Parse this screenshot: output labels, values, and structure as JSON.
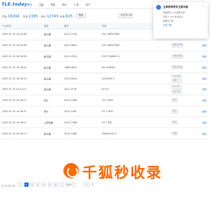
{
  "header": {
    "logo_text": "TLE.today",
    "nav": [
      "首页",
      "卫星",
      "发射",
      "碎片",
      "工具",
      "关于"
    ]
  },
  "stats": {
    "items": [
      {
        "label": "在轨",
        "value": "18294"
      },
      {
        "label": "失效",
        "value": "2395"
      },
      {
        "label": "碎片",
        "value": "12743"
      },
      {
        "label": "未知",
        "value": "825"
      }
    ],
    "search_label": "搜索",
    "sort_label": "按发射时间"
  },
  "table": {
    "columns": [
      "TLE时间",
      "类型",
      "编号",
      "名称",
      "",
      ""
    ],
    "rows": [
      {
        "time": "2025-07-15 10:44:48",
        "type": "航天器",
        "orb": "2022-143A",
        "name": "CSS (WENTIAN)",
        "tags": [
          "中国空间站"
        ],
        "link": "详情"
      },
      {
        "time": "2025-07-15 10:44:48",
        "type": "航天器",
        "orb": "2022-065A",
        "name": "CSS (WENTIAN)",
        "tags": [
          "中国空间站"
        ],
        "link": "详情"
      },
      {
        "time": "2025-07-15 10:36:34",
        "type": "航天器",
        "orb": "2021-035A",
        "name": "CSS (TIANHE-1)",
        "tags": [
          "中国空间站"
        ],
        "link": "详情"
      },
      {
        "time": "2025-07-15 10:36:21",
        "type": "航天器",
        "orb": "1998-067A",
        "name": "ISS (ZARYA)",
        "tags": [
          "国际空间站"
        ],
        "link": "详情"
      },
      {
        "time": "2025-07-15 10:36:34",
        "type": "航天器",
        "orb": "2013-049A",
        "name": "LILACSAT 2",
        "tags": [
          "CLASSIC",
          "中国"
        ],
        "link": "详情"
      },
      {
        "time": "2025-07-15 01:14:11",
        "type": "航天器",
        "orb": "2017-073E",
        "name": "AO-91",
        "tags": [
          "Fox-1B",
          "业余卫星"
        ],
        "link": "详情"
      },
      {
        "time": "2025-07-15 10:36:17",
        "type": "碎片",
        "orb": "2025-148D",
        "name": "CZ-7 DEB",
        "tags": [
          "碎片"
        ],
        "link": "详情"
      },
      {
        "time": "2025-07-15 10:36:31",
        "type": "碎片",
        "orb": "2025-148C",
        "name": "CZ-7 DEB",
        "tags": [
          "碎片"
        ],
        "link": "详情"
      },
      {
        "time": "2025-07-15 10:36:17",
        "type": "火箭残骸",
        "orb": "2025-148B",
        "name": "CZ-7 R/B",
        "tags": [
          "碎片"
        ],
        "link": "详情"
      },
      {
        "time": "2025-07-15 10:36:17",
        "type": "航天器",
        "orb": "2025-148A",
        "name": "TIANZHOU-9",
        "tags": [
          "中国"
        ],
        "link": "详情"
      }
    ]
  },
  "pagination": {
    "total": "共 28,041 条",
    "pages": [
      "‹",
      "1",
      "2",
      "3",
      "4",
      "5",
      "6",
      "…",
      "2337",
      "›"
    ],
    "active_index": 1,
    "goto_value": "1",
    "goto_label": "页"
  },
  "notification": {
    "title": "立即获得更多卫星功能",
    "lines": [
      "查看所有 TLE 更新记录",
      "自定义 TLE 关注列表",
      "提醒与订阅",
      "点击了解"
    ]
  },
  "watermark": {
    "text": "千狐秒收录"
  },
  "colors": {
    "accent": "#1e73d9",
    "watermark": "#ff6a00"
  }
}
